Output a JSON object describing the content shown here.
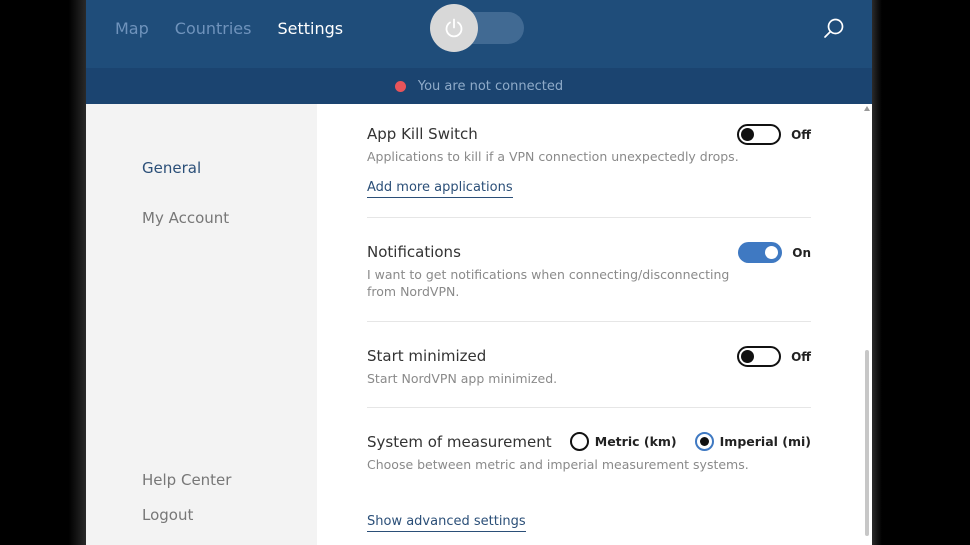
{
  "nav": {
    "map": "Map",
    "countries": "Countries",
    "settings": "Settings"
  },
  "status": {
    "text": "You are not connected",
    "color": "#e8545a"
  },
  "sidebar": {
    "general": "General",
    "my_account": "My Account",
    "help_center": "Help Center",
    "logout": "Logout"
  },
  "settings": {
    "kill_switch": {
      "title": "App Kill Switch",
      "description": "Applications to kill if a VPN connection unexpectedly drops.",
      "state": "Off",
      "link": "Add more applications"
    },
    "notifications": {
      "title": "Notifications",
      "description": "I want to get notifications when connecting/disconnecting from NordVPN.",
      "state": "On"
    },
    "start_minimized": {
      "title": "Start minimized",
      "description": "Start NordVPN app minimized.",
      "state": "Off"
    },
    "measurement": {
      "title": "System of measurement",
      "description": "Choose between metric and imperial measurement systems.",
      "options": [
        "Metric (km)",
        "Imperial (mi)"
      ],
      "selected": "Imperial (mi)"
    },
    "advanced_link": "Show advanced settings"
  },
  "colors": {
    "header": "#1f4d7a",
    "accent": "#3f79c2"
  },
  "icons": {
    "power": "power-icon",
    "search": "search-icon"
  }
}
